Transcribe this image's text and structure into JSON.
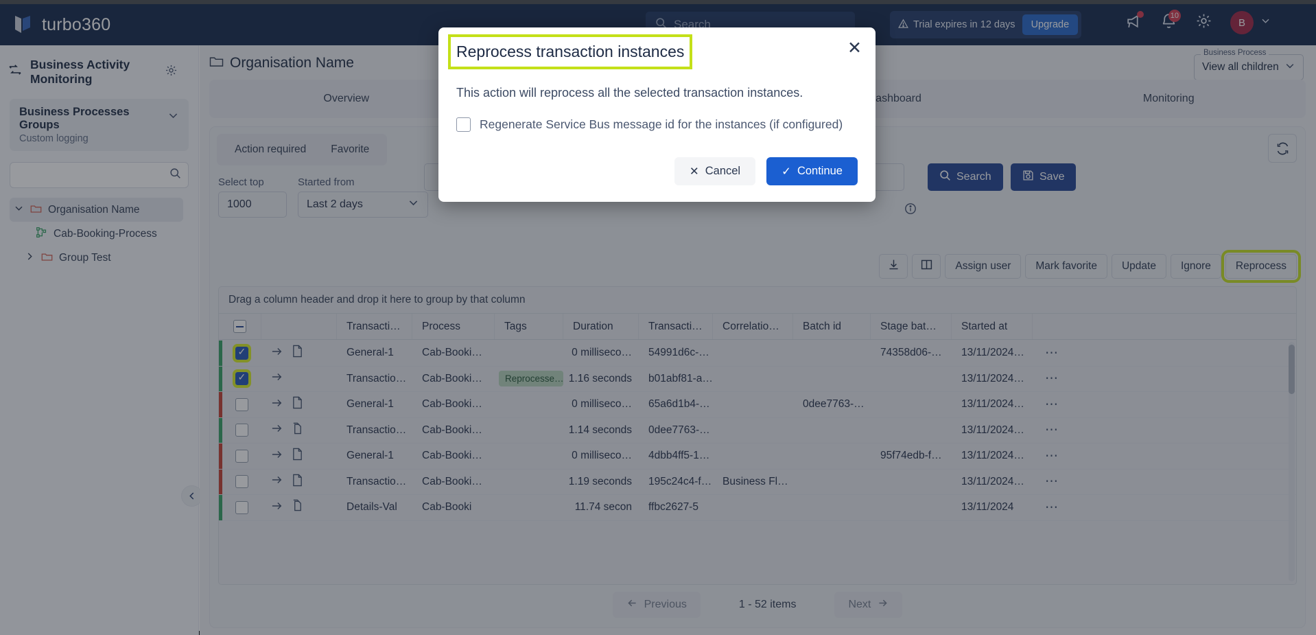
{
  "topnav": {
    "brand": "turbo360",
    "search_placeholder": "Search",
    "trial_text": "Trial expires in 12 days",
    "upgrade_label": "Upgrade",
    "notification_count": "10",
    "avatar_initial": "B"
  },
  "sidebar": {
    "title": "Business Activity Monitoring",
    "group": {
      "title": "Business Processes Groups",
      "subtitle": "Custom logging"
    },
    "search_placeholder": "",
    "tree": [
      {
        "label": "Organisation Name",
        "type": "folder",
        "selected": true,
        "expanded": true
      },
      {
        "label": "Cab-Booking-Process",
        "type": "process",
        "selected": false,
        "expanded": false
      },
      {
        "label": "Group Test",
        "type": "folder",
        "selected": false,
        "expanded": false
      }
    ]
  },
  "main": {
    "breadcrumb": "Organisation Name",
    "business_process_label": "Business Process",
    "business_process_value": "View all children",
    "tabs": [
      {
        "label": "Overview"
      },
      {
        "label": ""
      },
      {
        "label": "Dashboard"
      },
      {
        "label": "Monitoring"
      }
    ],
    "subtabs": [
      {
        "label": "Action required"
      },
      {
        "label": "Favorite"
      }
    ],
    "filters": {
      "select_top_label": "Select top",
      "select_top_value": "1000",
      "started_from_label": "Started from",
      "started_from_value": "Last 2 days",
      "query_value": ""
    },
    "search_button": "Search",
    "save_button": "Save",
    "actions": [
      {
        "label": "",
        "icon": "download-icon"
      },
      {
        "label": "",
        "icon": "columns-icon"
      },
      {
        "label": "Assign user",
        "icon": ""
      },
      {
        "label": "Mark favorite",
        "icon": ""
      },
      {
        "label": "Update",
        "icon": ""
      },
      {
        "label": "Ignore",
        "icon": ""
      },
      {
        "label": "Reprocess",
        "icon": "",
        "highlighted": true
      }
    ],
    "grid": {
      "group_hint": "Drag a column header and drop it here to group by that column",
      "columns": [
        "Transacti…",
        "Process",
        "Tags",
        "Duration",
        "Transacti…",
        "Correlatio…",
        "Batch id",
        "Stage bat…",
        "Started at"
      ],
      "rows": [
        {
          "status": "green",
          "checked": true,
          "has_doc": true,
          "transaction": "General-1",
          "process": "Cab-Booki…",
          "tag": "",
          "duration": "0 milliseco…",
          "transaction_id": "54991d6c-…",
          "correlation": "",
          "batch_id": "",
          "stage_batch": "74358d06-…",
          "started_at": "13/11/2024…"
        },
        {
          "status": "green",
          "checked": true,
          "has_doc": false,
          "transaction": "Transactio…",
          "process": "Cab-Booki…",
          "tag": "Reprocesse…",
          "duration": "1.16 seconds",
          "transaction_id": "b01abf81-a…",
          "correlation": "",
          "batch_id": "",
          "stage_batch": "",
          "started_at": "13/11/2024…"
        },
        {
          "status": "red",
          "checked": false,
          "has_doc": true,
          "transaction": "General-1",
          "process": "Cab-Booki…",
          "tag": "",
          "duration": "0 milliseco…",
          "transaction_id": "65a6d1b4-…",
          "correlation": "",
          "batch_id": "0dee7763-…",
          "stage_batch": "",
          "started_at": "13/11/2024…"
        },
        {
          "status": "green",
          "checked": false,
          "has_doc": true,
          "transaction": "Transactio…",
          "process": "Cab-Booki…",
          "tag": "",
          "duration": "1.14 seconds",
          "transaction_id": "0dee7763-…",
          "correlation": "",
          "batch_id": "",
          "stage_batch": "",
          "started_at": "13/11/2024…"
        },
        {
          "status": "red",
          "checked": false,
          "has_doc": true,
          "transaction": "General-1",
          "process": "Cab-Booki…",
          "tag": "",
          "duration": "0 milliseco…",
          "transaction_id": "4dbb4ff5-1…",
          "correlation": "",
          "batch_id": "",
          "stage_batch": "95f74edb-f…",
          "started_at": "13/11/2024…"
        },
        {
          "status": "red",
          "checked": false,
          "has_doc": true,
          "transaction": "Transactio…",
          "process": "Cab-Booki…",
          "tag": "",
          "duration": "1.19 seconds",
          "transaction_id": "195c24c4-f…",
          "correlation": "Business Fl…",
          "batch_id": "",
          "stage_batch": "",
          "started_at": "13/11/2024…"
        },
        {
          "status": "green",
          "checked": false,
          "has_doc": true,
          "transaction": "Details-Val",
          "process": "Cab-Booki",
          "tag": "",
          "duration": "11.74 secon",
          "transaction_id": "ffbc2627-5",
          "correlation": "",
          "batch_id": "",
          "stage_batch": "",
          "started_at": "13/11/2024"
        }
      ]
    },
    "pager": {
      "previous": "Previous",
      "items_text": "1 - 52 items",
      "next": "Next"
    }
  },
  "modal": {
    "title": "Reprocess transaction instances",
    "description": "This action will reprocess all the selected transaction instances.",
    "checkbox_label": "Regenerate Service Bus message id for the instances (if configured)",
    "checkbox_checked": false,
    "cancel_label": "Cancel",
    "continue_label": "Continue"
  },
  "colors": {
    "navy": "#0d2145",
    "primary_blue": "#1b5fd1",
    "highlight_green": "#c4e019",
    "status_green": "#2f9e5e",
    "status_red": "#c0392b",
    "tag_green_bg": "#b4d4bb"
  }
}
